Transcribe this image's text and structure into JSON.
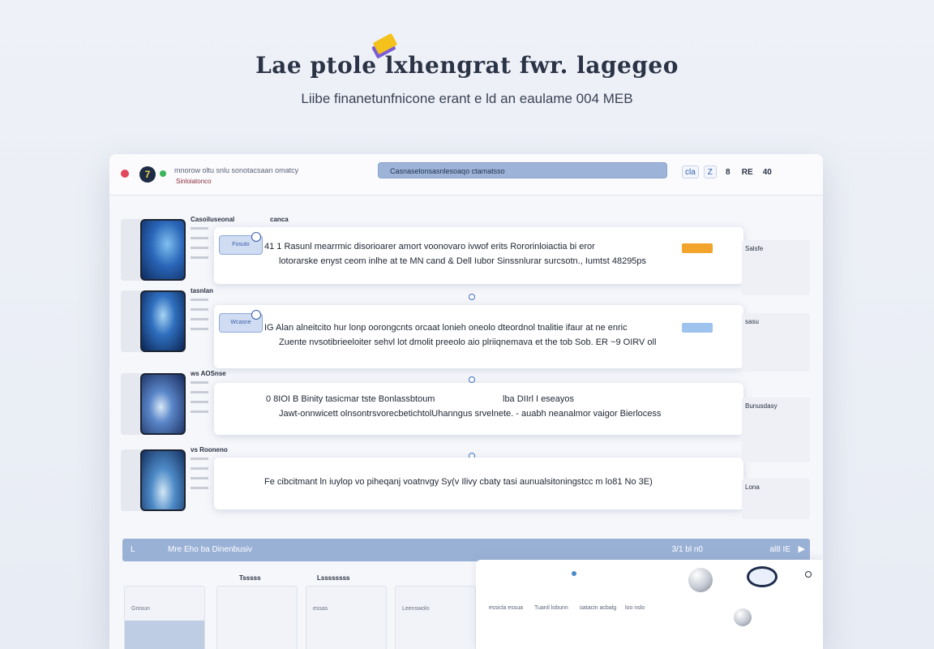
{
  "hero": {
    "title": "Lae ptole lxhengrat fwr. lagegeo",
    "subtitle": "Liibe finanetunfnicone erant e ld an eaulame 004 MEB"
  },
  "window": {
    "app_avatar_glyph": "7",
    "path_text": "mnorow oltu snlu  sonotacsaan omatcy",
    "subpath_text": "Sinloiatonco",
    "search_value": "Casnaselonsasnlesoaqo ctamatsso",
    "tools": [
      "cla",
      "Z",
      "8",
      "RE",
      "40"
    ]
  },
  "rows": [
    {
      "title": "Casoiluseonal",
      "title2": "canca",
      "badge": "Fosuto",
      "line1": "41  1  Rasunl mearrmic disorioarer amort voonovaro ivwof erits Rororinloiactia bi eror",
      "line2": "lotorarske enyst ceom inlhe at te MN cand & Dell Iubor Sinssnlurar surcsotn., Iumtst 48295ps",
      "tag_color": "#f3a42c",
      "right": "Salsfe"
    },
    {
      "title": "tasnlan",
      "badge": "Wcasne",
      "line1": "IG  Alan alneitcito hur lonp oorongcnts orcaat lonieh oneolo dteordnol tnalitie ifaur at ne enric",
      "line2": "Zuente nvsotibrieeloiter sehvl lot dmolit preeolo aio plriiqnemava et the tob Sob. ER ~9 OIRV oll",
      "tag_color": "#9ec3ef",
      "right": "sasu"
    },
    {
      "title": "ws AOSnse",
      "badge": "",
      "line1": "0  8IOI  B  Binity tasicmar tste Bonlassbtoum",
      "line1b": "lba DIIrl  I  eseayos",
      "line2": "Jawt-onnwicett olnsontrsvorecbetichtolUhanngus srvelnete. - auabh neanalmor vaigor Bierlocess",
      "tag_color": "",
      "right": "Bunusdasy"
    },
    {
      "title": "vs Rooneno",
      "badge": "",
      "line1": "Fe cibcitmant ln iuylop vo piheqanj voatnvgy Sy(v Ilivy  cbaty tasi aunualsitoningstcc m lo81 No 3E)",
      "line2": "",
      "tag_color": "",
      "right": "Lona"
    }
  ],
  "bottom_bar": {
    "left": "L",
    "label": "Mre Eho ba Dinenbusiv",
    "right": "3/1 bl n0",
    "tools": "al8  IE",
    "play": "▶"
  },
  "tiles": [
    {
      "label": "",
      "text": "Grosun"
    },
    {
      "label": "Tsssss",
      "text": ""
    },
    {
      "label": "Lssssssss",
      "text": "essas"
    },
    {
      "label": "",
      "text": "Leenswolo"
    }
  ],
  "bottom_panel": {
    "cols": [
      "essicla essua",
      "Tuanil lobunn",
      "oatacin acbalg",
      "loo nslo"
    ]
  }
}
